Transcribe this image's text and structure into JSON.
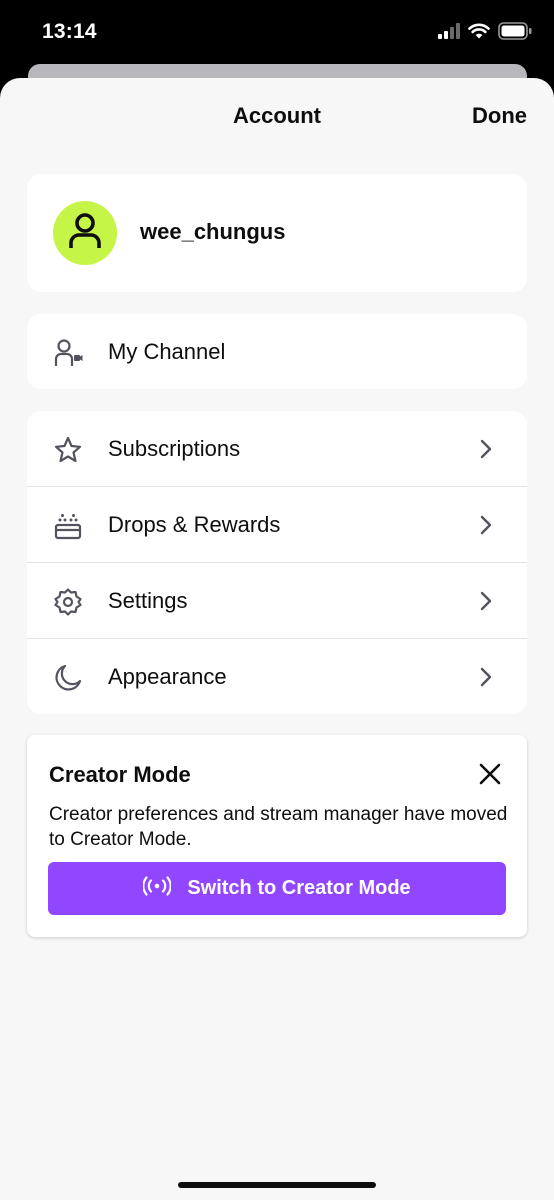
{
  "status_bar": {
    "time": "13:14",
    "icons": [
      "cellular-signal-icon",
      "wifi-icon",
      "battery-icon"
    ]
  },
  "header": {
    "title": "Account",
    "done_label": "Done"
  },
  "profile": {
    "username": "wee_chungus",
    "avatar_icon": "user-icon",
    "avatar_color": "#c4f547"
  },
  "channel": {
    "label": "My Channel",
    "icon": "channel-icon"
  },
  "menu": {
    "items": [
      {
        "label": "Subscriptions",
        "icon": "star-icon"
      },
      {
        "label": "Drops & Rewards",
        "icon": "drops-icon"
      },
      {
        "label": "Settings",
        "icon": "gear-icon"
      },
      {
        "label": "Appearance",
        "icon": "moon-icon"
      }
    ]
  },
  "creator_mode": {
    "title": "Creator Mode",
    "description": "Creator preferences and stream manager have moved to Creator Mode.",
    "button_label": "Switch to Creator Mode",
    "button_icon": "broadcast-icon",
    "accent_color": "#9147ff"
  }
}
